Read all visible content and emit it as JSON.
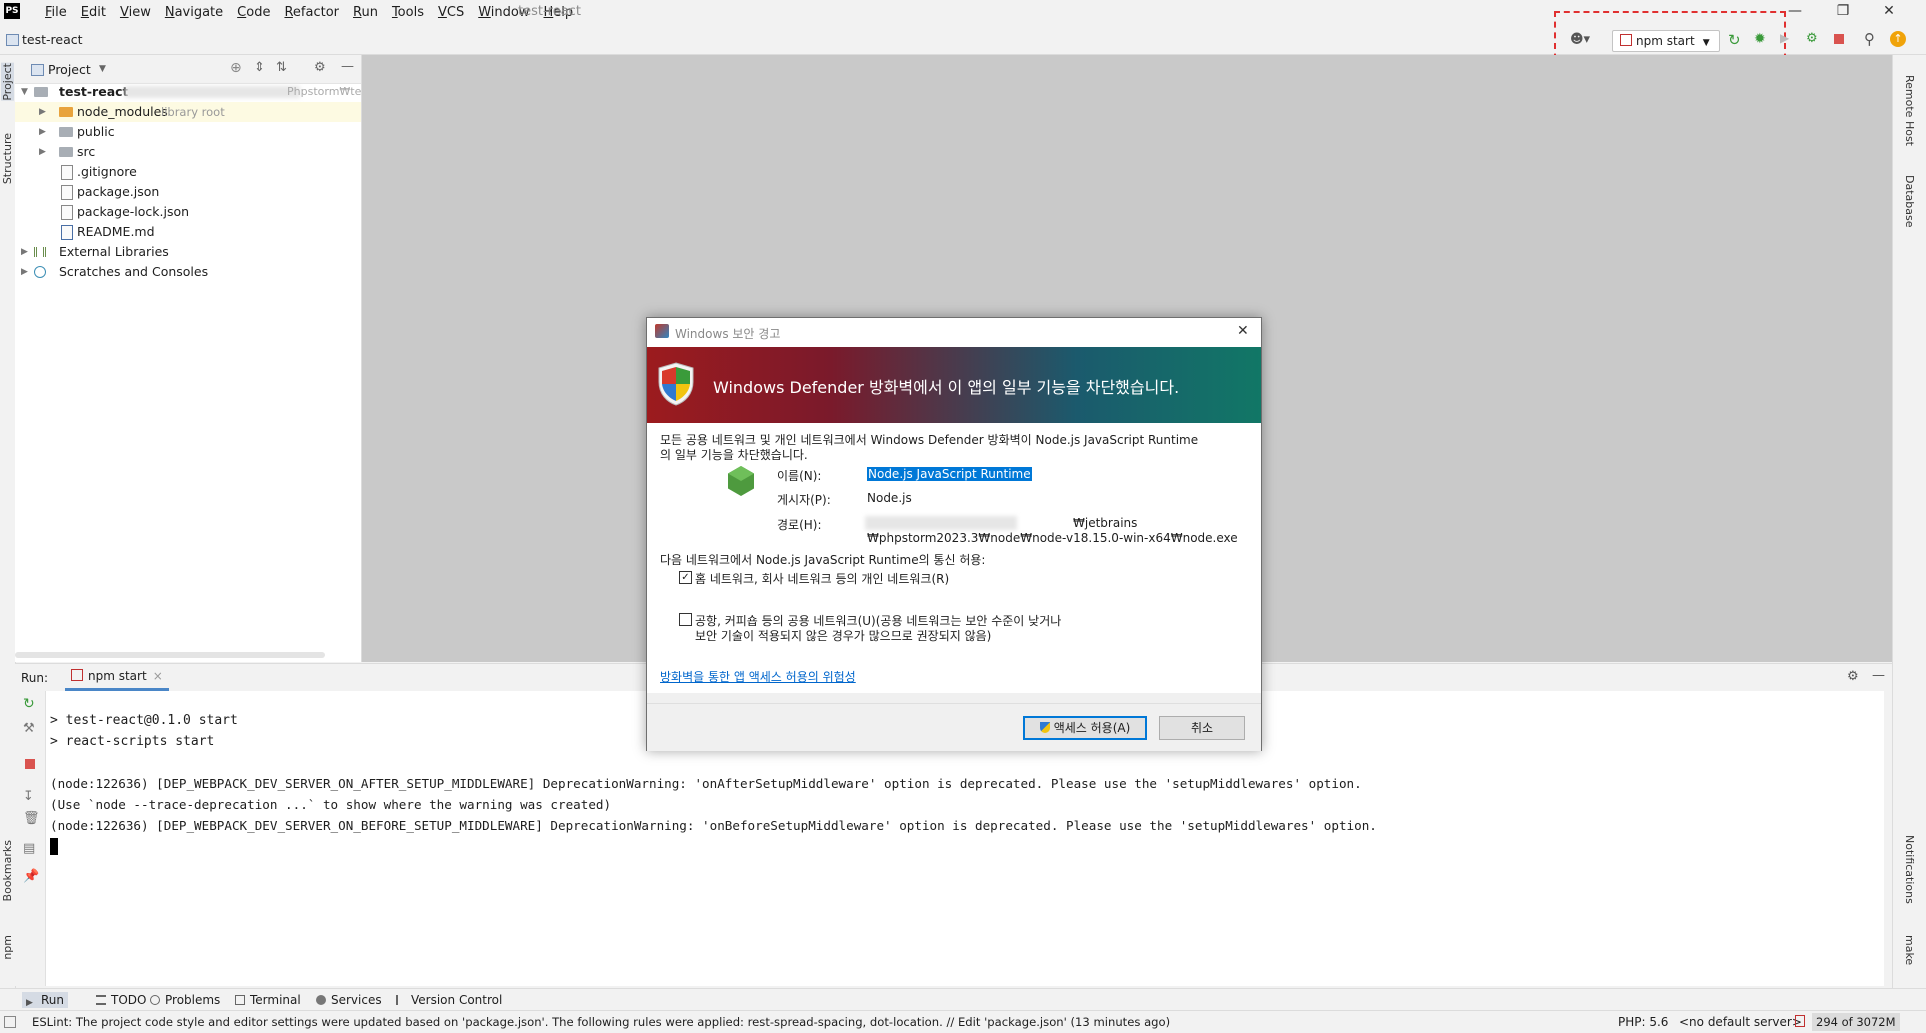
{
  "app": {
    "logo": "PS",
    "menu": [
      "File",
      "Edit",
      "View",
      "Navigate",
      "Code",
      "Refactor",
      "Run",
      "Tools",
      "VCS",
      "Window",
      "Help"
    ],
    "project_title": "test-react"
  },
  "navbar": {
    "breadcrumb": "test-react",
    "run_config": "npm start"
  },
  "project_panel": {
    "title": "Project",
    "root": {
      "name": "test-react",
      "path_hint": "Phpstorm₩tes"
    },
    "items": [
      {
        "name": "node_modules",
        "note": "library root"
      },
      {
        "name": "public"
      },
      {
        "name": "src"
      },
      {
        "name": ".gitignore"
      },
      {
        "name": "package.json"
      },
      {
        "name": "package-lock.json"
      },
      {
        "name": "README.md"
      },
      {
        "name": "External Libraries"
      },
      {
        "name": "Scratches and Consoles"
      }
    ]
  },
  "left_stripe": {
    "top": [
      "Project",
      "Structure"
    ],
    "bottom": [
      "Bookmarks",
      "npm"
    ]
  },
  "right_stripe": {
    "top": [
      "Remote Host",
      "Database"
    ],
    "bottom": [
      "Notifications",
      "make"
    ]
  },
  "run_panel": {
    "label": "Run:",
    "tab": "npm start",
    "console_lines": [
      "> test-react@0.1.0 start",
      "> react-scripts start",
      "",
      "(node:122636) [DEP_WEBPACK_DEV_SERVER_ON_AFTER_SETUP_MIDDLEWARE] DeprecationWarning: 'onAfterSetupMiddleware' option is deprecated. Please use the 'setupMiddlewares' option.",
      "(Use `node --trace-deprecation ...` to show where the warning was created)",
      "(node:122636) [DEP_WEBPACK_DEV_SERVER_ON_BEFORE_SETUP_MIDDLEWARE] DeprecationWarning: 'onBeforeSetupMiddleware' option is deprecated. Please use the 'setupMiddlewares' option."
    ]
  },
  "bottom_tabs": [
    "Run",
    "TODO",
    "Problems",
    "Terminal",
    "Services",
    "Version Control"
  ],
  "status": {
    "message": "ESLint: The project code style and editor settings were updated based on 'package.json'. The following rules were applied: rest-spread-spacing, dot-location. // Edit 'package.json' (13 minutes ago)",
    "php": "PHP: 5.6",
    "server": "<no default server>",
    "memory": "294 of 3072M"
  },
  "dialog": {
    "title": "Windows 보안 경고",
    "banner": "Windows Defender 방화벽에서 이 앱의 일부 기능을 차단했습니다.",
    "intro_line1": "모든 공용 네트워크 및 개인 네트워크에서 Windows Defender 방화벽이 Node.js JavaScript Runtime",
    "intro_line2": "의 일부 기능을 차단했습니다.",
    "name_label": "이름(N):",
    "name_value": "Node.js JavaScript Runtime",
    "publisher_label": "게시자(P):",
    "publisher_value": "Node.js",
    "path_label": "경로(H):",
    "path_value_1": "₩jetbrains",
    "path_value_2": "₩phpstorm2023.3₩node₩node-v18.15.0-win-x64₩node.exe",
    "allow_heading": "다음 네트워크에서 Node.js JavaScript Runtime의 통신 허용:",
    "private_option": "홈 네트워크, 회사 네트워크 등의 개인 네트워크(R)",
    "public_option_1": "공항, 커피숍 등의 공용 네트워크(U)(공용 네트워크는 보안 수준이 낮거나",
    "public_option_2": "보안 기술이 적용되지 않은 경우가 많으므로 권장되지 않음)",
    "private_checked": true,
    "public_checked": false,
    "risk_link": "방화벽을 통한 앱 액세스 허용의 위험성",
    "allow_button": "액세스 허용(A)",
    "cancel_button": "취소"
  }
}
